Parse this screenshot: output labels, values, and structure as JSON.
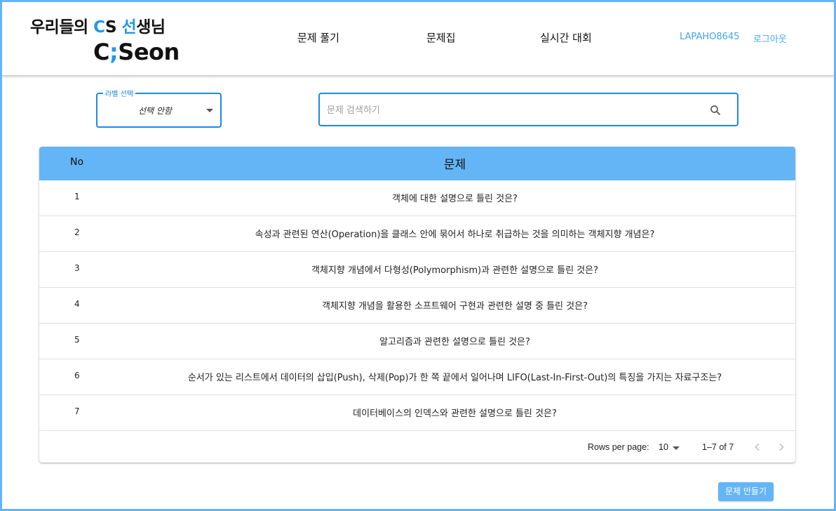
{
  "header": {
    "logo_line1_prefix": "우리들의 ",
    "logo_line1_accent_c": "C",
    "logo_line1_s": "S ",
    "logo_line1_accent_seon": "선",
    "logo_line1_suffix": "생님",
    "logo_line2_c": "C",
    "logo_line2_semicolon": ";",
    "logo_line2_rest": "Seon",
    "nav": [
      "문제 풀기",
      "문제집",
      "실시간 대회"
    ],
    "username": "LAPAHO8645",
    "logout": "로그아웃"
  },
  "filters": {
    "label_select_title": "라벨 선택",
    "label_select_value": "선택 안함",
    "search_placeholder": "문제 검색하기",
    "search_value": ""
  },
  "table": {
    "col_no": "No",
    "col_question": "문제",
    "rows": [
      {
        "no": "1",
        "q": "객체에 대한 설명으로 틀린 것은?"
      },
      {
        "no": "2",
        "q": "속성과 관련된 연산(Operation)을 클래스 안에 묶어서 하나로 취급하는 것을 의미하는 객체지향 개념은?"
      },
      {
        "no": "3",
        "q": "객체지향 개념에서 다형성(Polymorphism)과 관련한 설명으로 틀린 것은?"
      },
      {
        "no": "4",
        "q": "객체지향 개념을 활용한 소프트웨어 구현과 관련한 설명 중 틀린 것은?"
      },
      {
        "no": "5",
        "q": "알고리즘과 관련한 설명으로 틀린 것은?"
      },
      {
        "no": "6",
        "q": "순서가 있는 리스트에서 데이터의 삽입(Push), 삭제(Pop)가 한 쪽 끝에서 일어나며 LIFO(Last-In-First-Out)의 특징을 가지는 자료구조는?"
      },
      {
        "no": "7",
        "q": "데이터베이스의 인덱스와 관련한 설명으로 틀린 것은?"
      }
    ]
  },
  "pagination": {
    "rows_per_page_label": "Rows per page:",
    "rows_per_page_value": "10",
    "range": "1–7 of 7"
  },
  "actions": {
    "create_label": "문제 만들기"
  },
  "colors": {
    "accent": "#64b5f6",
    "primary": "#1e88e5",
    "link": "#42a5f5"
  }
}
